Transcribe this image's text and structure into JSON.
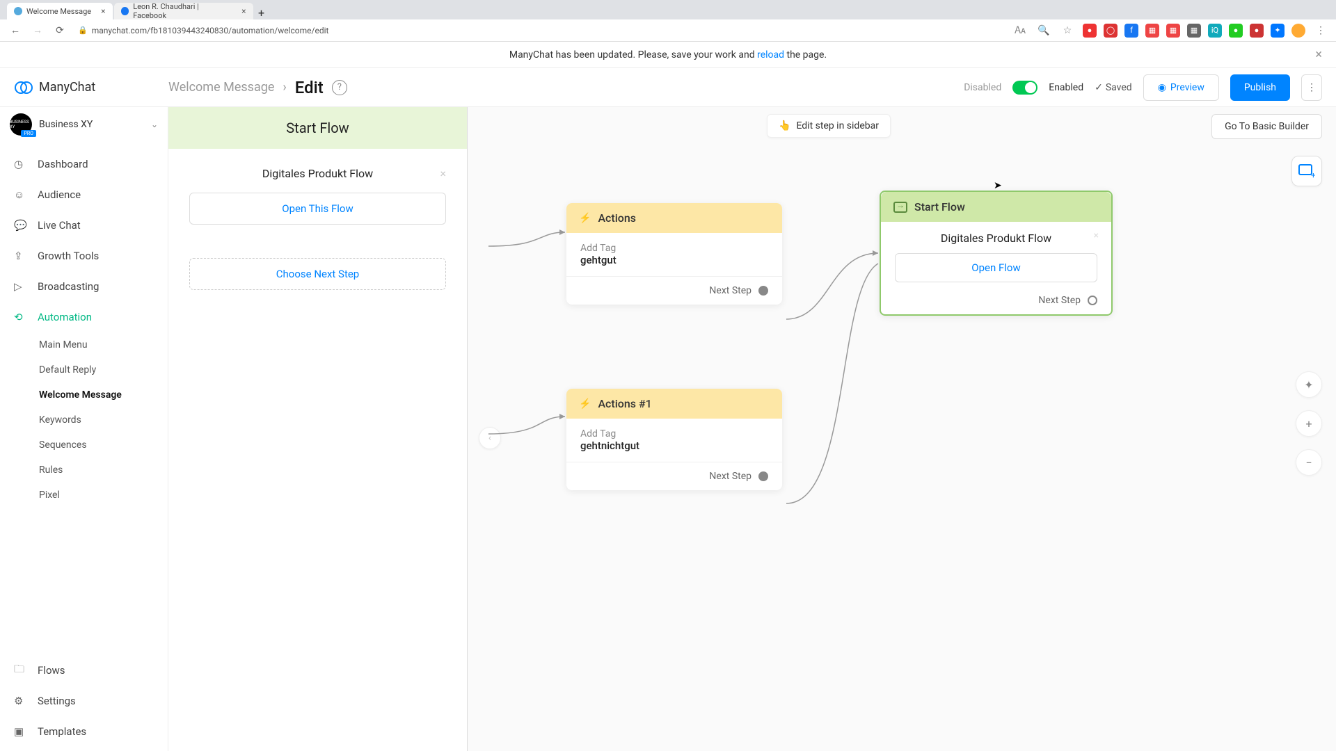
{
  "browser": {
    "tabs": [
      {
        "title": "Welcome Message",
        "active": true
      },
      {
        "title": "Leon R. Chaudhari | Facebook",
        "active": false
      }
    ],
    "url": "manychat.com/fb181039443240830/automation/welcome/edit"
  },
  "banner": {
    "text_before": "ManyChat has been updated. Please, save your work and ",
    "link": "reload",
    "text_after": " the page."
  },
  "brand": "ManyChat",
  "breadcrumb": {
    "flow": "Welcome Message",
    "page": "Edit"
  },
  "header": {
    "disabled": "Disabled",
    "enabled": "Enabled",
    "saved": "Saved",
    "preview": "Preview",
    "publish": "Publish"
  },
  "org": {
    "name": "Business XY",
    "badge": "PRO"
  },
  "nav": {
    "items": [
      {
        "label": "Dashboard"
      },
      {
        "label": "Audience"
      },
      {
        "label": "Live Chat"
      },
      {
        "label": "Growth Tools"
      },
      {
        "label": "Broadcasting"
      },
      {
        "label": "Automation",
        "active": true
      }
    ],
    "sub": [
      {
        "label": "Main Menu"
      },
      {
        "label": "Default Reply"
      },
      {
        "label": "Welcome Message",
        "active": true
      },
      {
        "label": "Keywords"
      },
      {
        "label": "Sequences"
      },
      {
        "label": "Rules"
      },
      {
        "label": "Pixel"
      }
    ],
    "bottom": [
      {
        "label": "Flows"
      },
      {
        "label": "Settings"
      },
      {
        "label": "Templates"
      }
    ]
  },
  "hint": "Edit step in sidebar",
  "basic_builder": "Go To Basic Builder",
  "inspector": {
    "head": "Start Flow",
    "title": "Digitales Produkt Flow",
    "open": "Open This Flow",
    "choose": "Choose Next Step"
  },
  "nodes": {
    "actions1": {
      "title": "Actions",
      "tag_label": "Add Tag",
      "tag_value": "gehtgut",
      "next": "Next Step"
    },
    "actions2": {
      "title": "Actions #1",
      "tag_label": "Add Tag",
      "tag_value": "gehtnichtgut",
      "next": "Next Step"
    },
    "startflow": {
      "title": "Start Flow",
      "flow_name": "Digitales Produkt Flow",
      "open": "Open Flow",
      "next": "Next Step"
    }
  }
}
